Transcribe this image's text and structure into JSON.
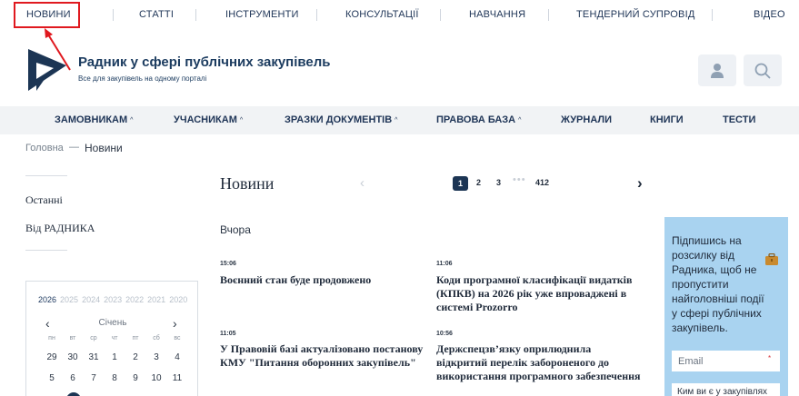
{
  "topnav": {
    "items": [
      "НОВИНИ",
      "СТАТТІ",
      "ІНСТРУМЕНТИ",
      "КОНСУЛЬТАЦІЇ",
      "НАВЧАННЯ",
      "ТЕНДЕРНИЙ СУПРОВІД",
      "ВІДЕО"
    ]
  },
  "header": {
    "title": "Радник у сфері публічних закупівель",
    "subtitle": "Все для закупівель на одному порталі",
    "user_icon": "user-icon",
    "search_icon": "search-icon"
  },
  "mainnav": {
    "items": [
      "ЗАМОВНИКАМ",
      "УЧАСНИКАМ",
      "ЗРАЗКИ ДОКУМЕНТІВ",
      "ПРАВОВА БАЗА",
      "ЖУРНАЛИ",
      "КНИГИ",
      "ТЕСТИ"
    ]
  },
  "breadcrumb": {
    "home": "Головна",
    "separator": "—",
    "current": "Новини"
  },
  "sidebar": {
    "links": [
      "Останні",
      "Від РАДНИКА"
    ],
    "calendar": {
      "years": [
        "2026",
        "2025",
        "2024",
        "2023",
        "2022",
        "2021",
        "2020"
      ],
      "month": "Січень",
      "weekdays": [
        "пн",
        "вт",
        "ср",
        "чт",
        "пт",
        "сб",
        "вс"
      ],
      "week1": [
        "29",
        "30",
        "31",
        "1",
        "2",
        "3",
        "4"
      ],
      "week2": [
        "5",
        "6",
        "7",
        "8",
        "9",
        "10",
        "11"
      ]
    }
  },
  "content": {
    "title": "Новини",
    "pagination": {
      "active": "1",
      "pages": [
        "2",
        "3"
      ],
      "dots": "•••",
      "last": "412"
    },
    "day_label": "Вчора",
    "news": [
      {
        "time": "15:06",
        "title": "Воєнний стан буде продовжено"
      },
      {
        "time": "11:06",
        "title": "Коди програмної класифікації видатків (КПКВ) на 2026 рік уже впроваджені в системі Prozorro"
      },
      {
        "time": "11:05",
        "title": "У Правовій базі актуалізовано постанову КМУ \"Питання оборонних закупівель\""
      },
      {
        "time": "10:56",
        "title": "Держспецзв’язку оприлюднила відкритий перелік забороненого до використання програмного забезпечення"
      }
    ]
  },
  "subscribe": {
    "text": "Підпишись на розсилку від Радника, щоб не пропустити найголовніші події у сфері публічних закупівель.",
    "email_placeholder": "Email",
    "required_mark": "*",
    "select_value": "Ким ви є у закупівлях"
  },
  "colors": {
    "accent": "#1c3554",
    "highlight": "#e0191f",
    "subscribe_bg": "#a9d3f0"
  }
}
